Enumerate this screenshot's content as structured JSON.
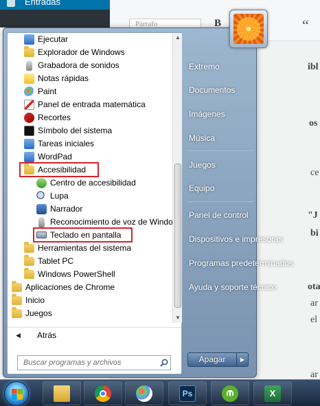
{
  "background": {
    "sidebar_entradas": "Entradas",
    "paragraph_select": "Párrafo",
    "bold_glyph": "B",
    "quote_glyph": "“",
    "snippets": [
      "ibl",
      "os",
      "ce",
      "\"J",
      "bi",
      "ota",
      "ar",
      "el",
      "ar"
    ]
  },
  "start_menu": {
    "programs": [
      {
        "label": "Ejecutar",
        "icon": "run-icon"
      },
      {
        "label": "Explorador de Windows",
        "icon": "explorer-icon"
      },
      {
        "label": "Grabadora de sonidos",
        "icon": "microphone-icon"
      },
      {
        "label": "Notas rápidas",
        "icon": "sticky-notes-icon"
      },
      {
        "label": "Paint",
        "icon": "paint-icon"
      },
      {
        "label": "Panel de entrada matemática",
        "icon": "math-input-icon"
      },
      {
        "label": "Recortes",
        "icon": "snipping-tool-icon"
      },
      {
        "label": "Símbolo del sistema",
        "icon": "command-prompt-icon"
      },
      {
        "label": "Tareas iniciales",
        "icon": "getting-started-icon"
      },
      {
        "label": "WordPad",
        "icon": "wordpad-icon"
      },
      {
        "label": "Accesibilidad",
        "icon": "folder-icon"
      },
      {
        "label": "Centro de accesibilidad",
        "icon": "ease-of-access-icon"
      },
      {
        "label": "Lupa",
        "icon": "magnifier-icon"
      },
      {
        "label": "Narrador",
        "icon": "narrator-icon"
      },
      {
        "label": "Reconocimiento de voz de Windows",
        "icon": "speech-recognition-icon"
      },
      {
        "label": "Teclado en pantalla",
        "icon": "on-screen-keyboard-icon"
      },
      {
        "label": "Herramientas del sistema",
        "icon": "folder-icon"
      },
      {
        "label": "Tablet PC",
        "icon": "folder-icon"
      },
      {
        "label": "Windows PowerShell",
        "icon": "folder-icon"
      },
      {
        "label": "Aplicaciones de Chrome",
        "icon": "folder-icon"
      },
      {
        "label": "Inicio",
        "icon": "folder-icon"
      },
      {
        "label": "Juegos",
        "icon": "folder-icon"
      }
    ],
    "back_label": "Atrás",
    "search_placeholder": "Buscar programas y archivos",
    "right_items": [
      "Extremo",
      "Documentos",
      "Imágenes",
      "Música",
      "Juegos",
      "Equipo",
      "Panel de control",
      "Dispositivos e impresoras",
      "Programas predeterminados",
      "Ayuda y soporte técnico"
    ],
    "shutdown_label": "Apagar",
    "shutdown_arrow": "▶"
  },
  "taskbar": {
    "photoshop_label": "Ps",
    "excel_label": "X",
    "utorrent_label": "µ"
  },
  "colors": {
    "highlight_box": "#d9202a",
    "taskbar": "#1c2d44"
  }
}
